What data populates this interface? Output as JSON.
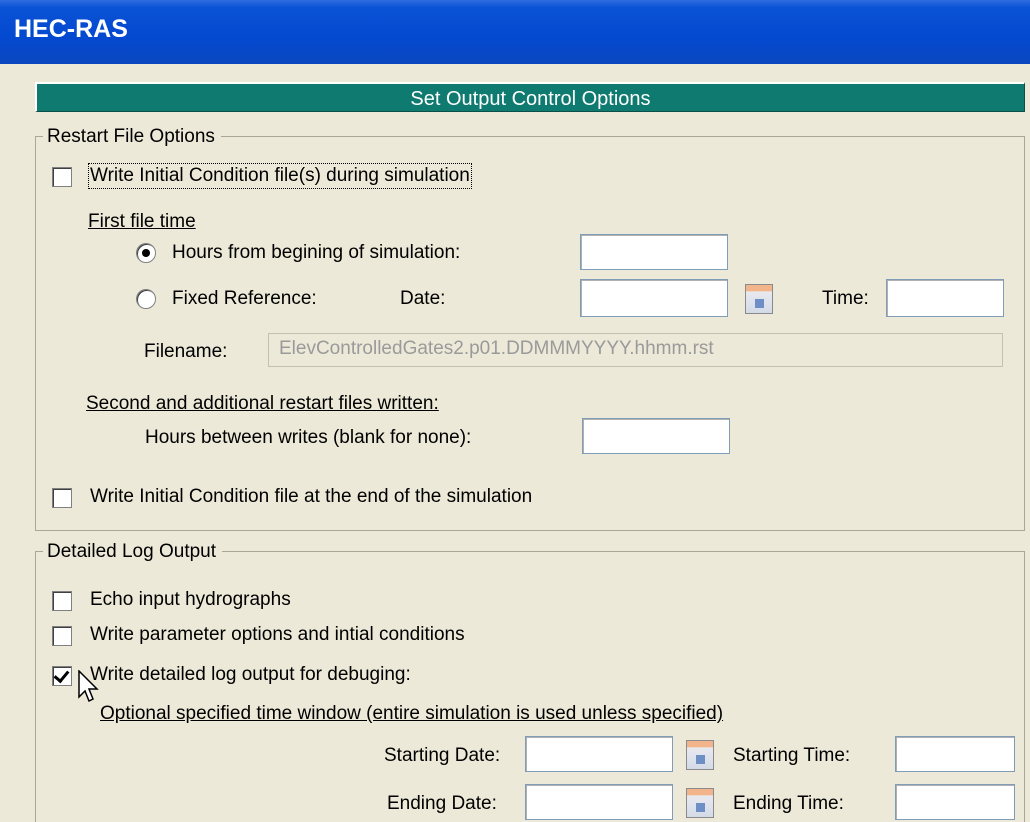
{
  "window": {
    "title": "HEC-RAS"
  },
  "header": {
    "title": "Set Output Control Options"
  },
  "restart": {
    "group_label": "Restart File Options",
    "write_ic_during": {
      "label": "Write Initial Condition file(s) during simulation",
      "checked": false
    },
    "first_file_time": "First file time",
    "hours_from_start": {
      "label": "Hours from begining of simulation:",
      "selected": true,
      "value": ""
    },
    "fixed_reference": {
      "label": "Fixed Reference:",
      "selected": false
    },
    "date_label": "Date:",
    "date_value": "",
    "time_label": "Time:",
    "time_value": "",
    "filename_label": "Filename:",
    "filename_value": "ElevControlledGates2.p01.DDMMMYYYY.hhmm.rst",
    "second_files": "Second and additional restart files written:",
    "hours_between": {
      "label": "Hours between writes (blank for none):",
      "value": ""
    },
    "write_ic_end": {
      "label": "Write Initial Condition file at the end of the simulation",
      "checked": false
    }
  },
  "log": {
    "group_label": "Detailed Log Output",
    "echo_hydrographs": {
      "label": "Echo input hydrographs",
      "checked": false
    },
    "write_parameters": {
      "label": "Write parameter options and intial conditions",
      "checked": false
    },
    "write_detailed": {
      "label": "Write detailed log output for debuging:",
      "checked": true
    },
    "time_window": "Optional specified time window (entire simulation is used unless specified)",
    "starting_date_label": "Starting Date:",
    "starting_date_value": "",
    "starting_time_label": "Starting Time:",
    "starting_time_value": "",
    "ending_date_label": "Ending Date:",
    "ending_date_value": "",
    "ending_time_label": "Ending Time:",
    "ending_time_value": ""
  }
}
